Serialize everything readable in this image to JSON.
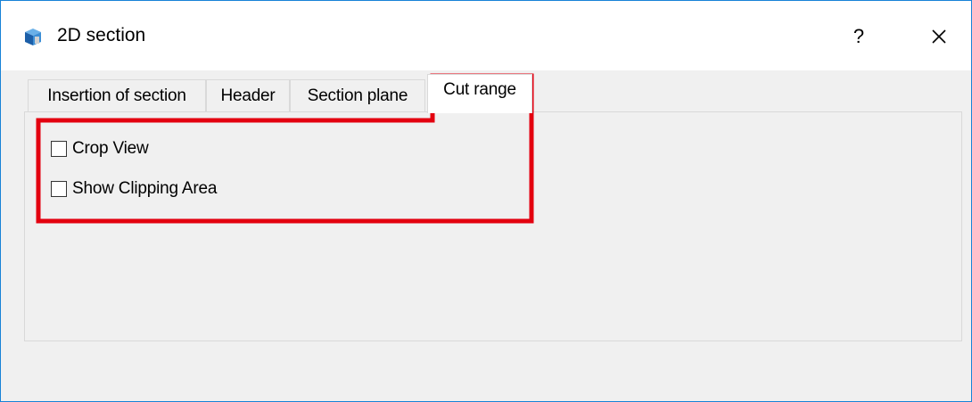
{
  "window": {
    "title": "2D section",
    "help_label": "?",
    "icon": "section-app-icon",
    "close_icon": "close-icon"
  },
  "tabs": [
    {
      "label": "Insertion of section",
      "active": false
    },
    {
      "label": "Header",
      "active": false
    },
    {
      "label": "Section plane",
      "active": false
    },
    {
      "label": "Cut range",
      "active": true
    }
  ],
  "cut_range": {
    "options": [
      {
        "label": "Crop View",
        "checked": false
      },
      {
        "label": "Show Clipping Area",
        "checked": false
      }
    ]
  },
  "highlight_color": "#e3000f",
  "accent_color": "#1883d7"
}
